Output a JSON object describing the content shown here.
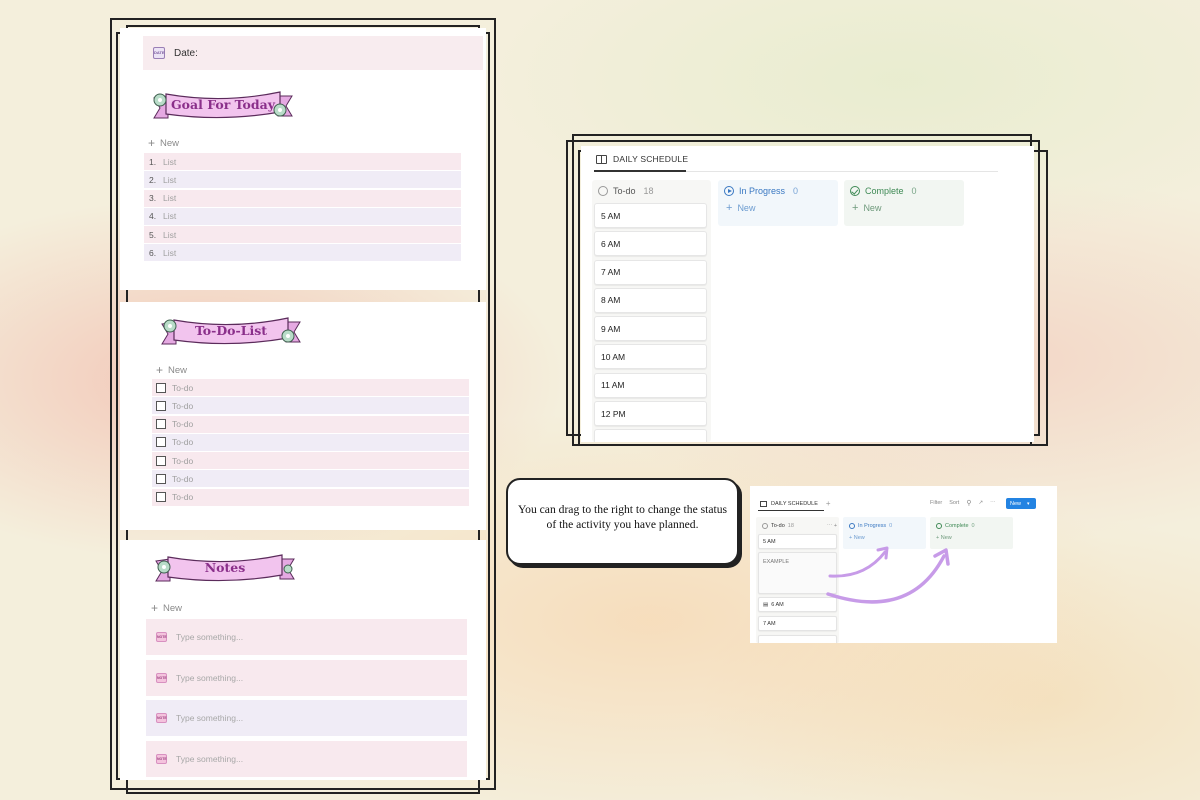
{
  "left_panel": {
    "date_label": "Date:",
    "goal_title": "Goal For Today",
    "goal_new": "New",
    "goal_items": [
      {
        "num": "1.",
        "text": "List"
      },
      {
        "num": "2.",
        "text": "List"
      },
      {
        "num": "3.",
        "text": "List"
      },
      {
        "num": "4.",
        "text": "List"
      },
      {
        "num": "5.",
        "text": "List"
      },
      {
        "num": "6.",
        "text": "List"
      }
    ],
    "todo_title": "To-Do-List",
    "todo_new": "New",
    "todo_items": [
      "To-do",
      "To-do",
      "To-do",
      "To-do",
      "To-do",
      "To-do",
      "To-do"
    ],
    "notes_title": "Notes",
    "notes_new": "New",
    "notes": [
      "Type something...",
      "Type something...",
      "Type something...",
      "Type something..."
    ]
  },
  "schedule": {
    "title": "DAILY SCHEDULE",
    "columns": [
      {
        "name": "To-do",
        "count": "18",
        "color": "#555555"
      },
      {
        "name": "In Progress",
        "count": "0",
        "color": "#3a78c2",
        "new_label": "New"
      },
      {
        "name": "Complete",
        "count": "0",
        "color": "#3f8a55",
        "new_label": "New"
      }
    ],
    "cards": [
      "5 AM",
      "6 AM",
      "7 AM",
      "8 AM",
      "9 AM",
      "10 AM",
      "11 AM",
      "12 PM"
    ]
  },
  "callout": {
    "text": "You can drag to the right to change the status of the activity you have planned."
  },
  "mini": {
    "title": "DAILY SCHEDULE",
    "filter": "Filter",
    "sort": "Sort",
    "new_button": "New",
    "todo_label": "To-do",
    "todo_count": "18",
    "inprogress_label": "In Progress",
    "inprogress_count": "0",
    "complete_label": "Complete",
    "complete_count": "0",
    "new_label": "New",
    "cards": [
      "5 AM",
      "EXAMPLE",
      "6 AM",
      "7 AM"
    ]
  },
  "colors": {
    "ribbon_fill": "#f2c4ee",
    "ribbon_text": "#8a2f8a",
    "list_pink": "#f8e9ee",
    "list_lavender": "#f0ecf6",
    "accent_blue": "#2383e2",
    "arrow_purple": "#c79be8"
  }
}
